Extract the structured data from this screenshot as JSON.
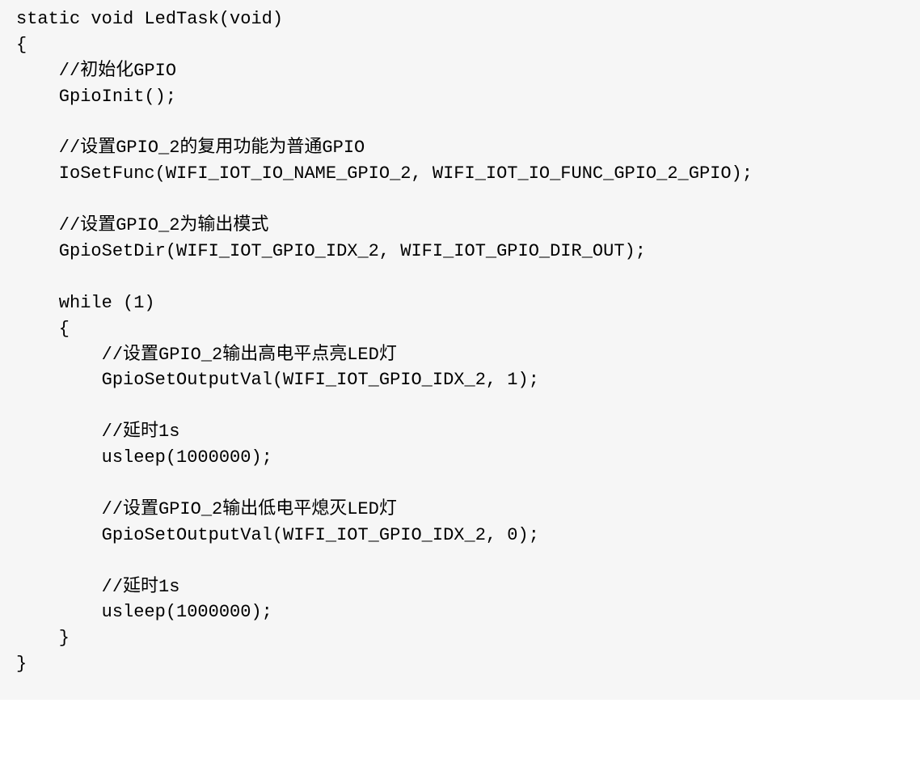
{
  "code": {
    "line1": "static void LedTask(void)",
    "line2": "{",
    "line3": "    //初始化GPIO",
    "line4": "    GpioInit();",
    "line5": "",
    "line6": "    //设置GPIO_2的复用功能为普通GPIO",
    "line7": "    IoSetFunc(WIFI_IOT_IO_NAME_GPIO_2, WIFI_IOT_IO_FUNC_GPIO_2_GPIO);",
    "line8": "",
    "line9": "    //设置GPIO_2为输出模式",
    "line10": "    GpioSetDir(WIFI_IOT_GPIO_IDX_2, WIFI_IOT_GPIO_DIR_OUT);",
    "line11": "",
    "line12": "    while (1)",
    "line13": "    {",
    "line14": "        //设置GPIO_2输出高电平点亮LED灯",
    "line15": "        GpioSetOutputVal(WIFI_IOT_GPIO_IDX_2, 1);",
    "line16": "",
    "line17": "        //延时1s",
    "line18": "        usleep(1000000);",
    "line19": "",
    "line20": "        //设置GPIO_2输出低电平熄灭LED灯",
    "line21": "        GpioSetOutputVal(WIFI_IOT_GPIO_IDX_2, 0);",
    "line22": "",
    "line23": "        //延时1s",
    "line24": "        usleep(1000000);",
    "line25": "    }",
    "line26": "}"
  }
}
